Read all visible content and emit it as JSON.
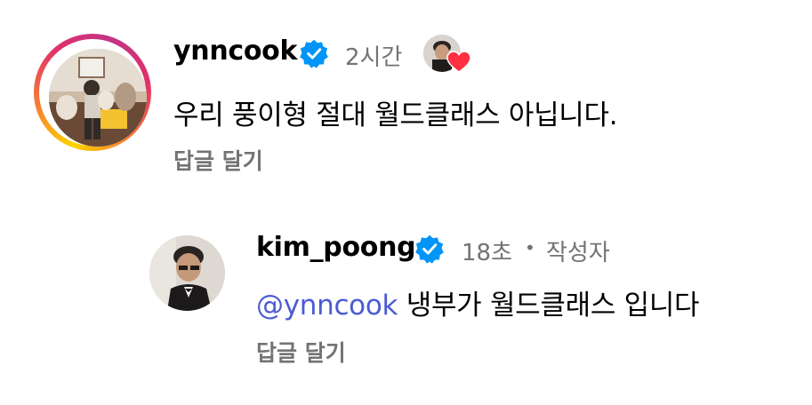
{
  "comments": [
    {
      "username": "ynncook",
      "time": "2시간",
      "text": "우리 풍이형 절대 월드클래스 아닙니다.",
      "reply_label": "답글 달기"
    }
  ],
  "replies": [
    {
      "username": "kim_poong",
      "time": "18초",
      "separator": "•",
      "author_badge": "작성자",
      "mention": "@ynncook",
      "text": "냉부가 월드클래스 입니다",
      "reply_label": "답글 달기"
    }
  ],
  "colors": {
    "verified_blue": "#0095f6",
    "mention": "#4c5bd4",
    "muted": "#737373",
    "like_heart": "#ff3040"
  },
  "icons": [
    "verified-badge-icon",
    "heart-icon",
    "threads-at-icon"
  ]
}
